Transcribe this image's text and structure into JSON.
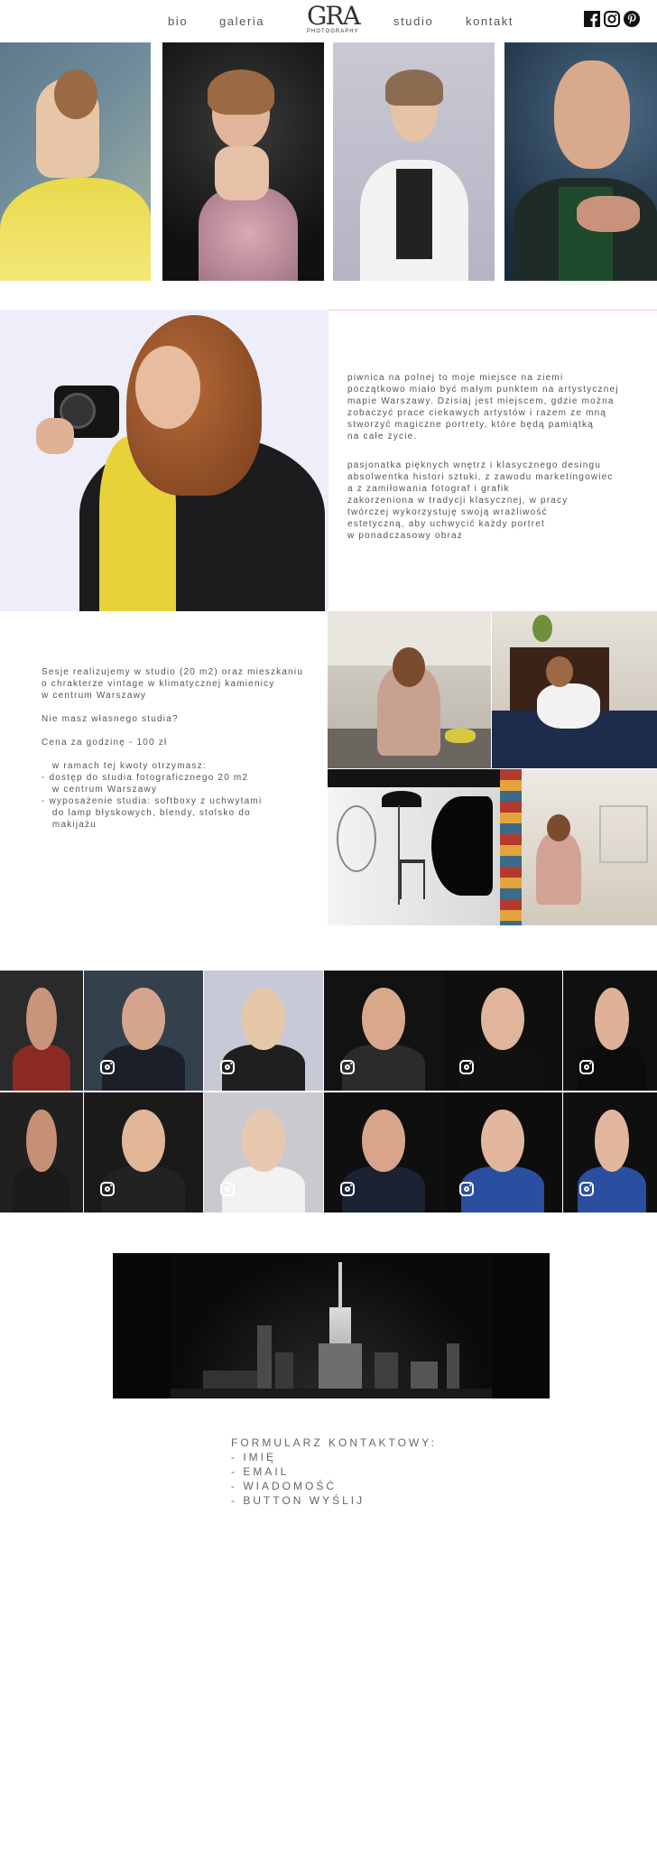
{
  "nav": {
    "bio": "bio",
    "galeria": "galeria",
    "studio": "studio",
    "kontakt": "kontakt",
    "logo_mark": "GRA",
    "logo_sub": "PHOTOGRAPHY"
  },
  "social": [
    "facebook-icon",
    "instagram-icon",
    "pinterest-icon"
  ],
  "bio": {
    "p1": [
      "piwnica na polnej to moje miejsce na ziemi",
      "początkowo miało być małym punktem na artystycznej",
      "mapie Warszawy. Dzisiaj jest miejscem, gdzie można",
      "zobaczyć prace ciekawych artystów i razem ze mną",
      "stworzyć magiczne portrety, które będą pamiątką",
      "na całe życie."
    ],
    "p2": [
      "pasjonatka pięknych wnętrz i klasycznego desingu",
      "absolwentka histori sztuki, z zawodu marketingowiec",
      "a z zamiłowania fotograf i grafik",
      "zakorzeniona w tradycji klasycznej, w pracy",
      "twórczej wykorzystuję swoją wrażliwość",
      "estetyczną, aby uchwycić każdy portret",
      "w ponadczasowy obraz"
    ]
  },
  "studio": {
    "lines": [
      "Sesje realizujemy w studio (20 m2) oraz mieszkaniu",
      "o chrakterze vintage w klimatycznej kamienicy",
      "w centrum Warszawy",
      "",
      "Nie masz własnego studia?",
      "",
      "Cena za godzinę - 100 zł",
      "",
      "   w ramach tej kwoty otrzymasz:",
      "- dostęp do studia fotograficznego 20 m2",
      "   w centrum Warszawy",
      "- wyposażenie studia: softboxy z uchwytami",
      "   do lamp błyskowych, blendy, stolsko do",
      "   makijażu"
    ]
  },
  "form": {
    "heading": "FORMULARZ KONTAKTOWY:",
    "items": [
      "- IMIĘ",
      "- EMAIL",
      "- WIADOMOŚĆ",
      "- BUTTON WYŚLIJ"
    ]
  },
  "colors": {
    "accent_pink": "#f4c2cc",
    "dark": "#111111",
    "text": "#555555"
  }
}
